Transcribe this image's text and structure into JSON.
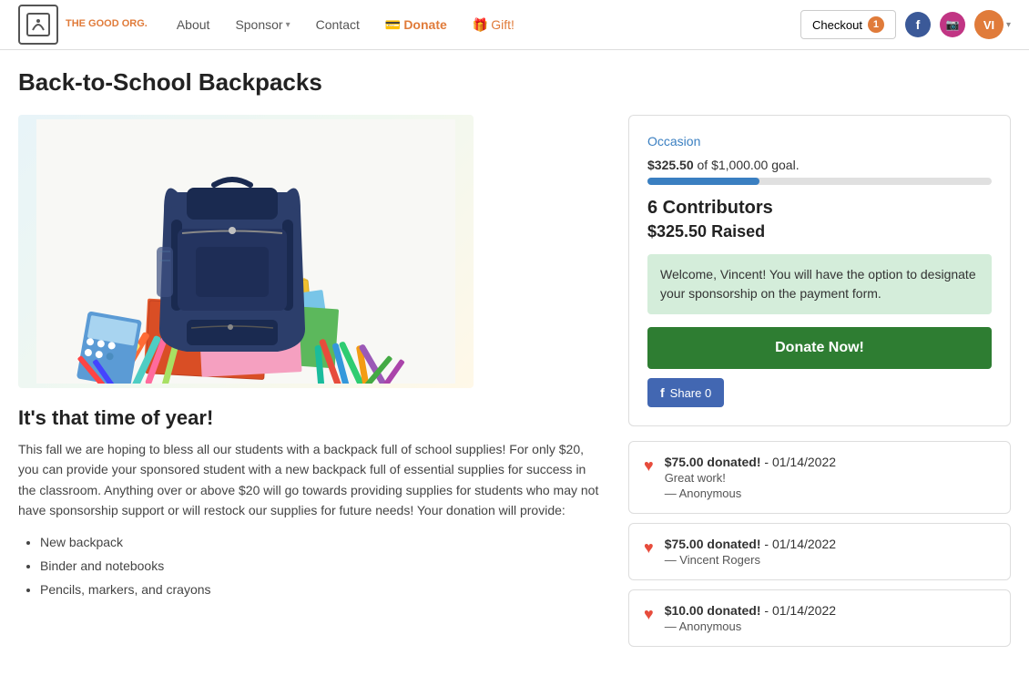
{
  "nav": {
    "logo_text": "THE GOOD ORG.",
    "logo_symbol": "🌿",
    "links": [
      {
        "label": "About",
        "id": "about"
      },
      {
        "label": "Sponsor",
        "id": "sponsor",
        "hasDropdown": true
      },
      {
        "label": "Contact",
        "id": "contact"
      },
      {
        "label": "Donate",
        "id": "donate",
        "icon": "💳"
      },
      {
        "label": "Gift!",
        "id": "gift",
        "icon": "🎁"
      }
    ],
    "checkout_label": "Checkout",
    "checkout_count": "1",
    "avatar_initials": "VI"
  },
  "page": {
    "title": "Back-to-School Backpacks"
  },
  "campaign": {
    "occasion_label": "Occasion",
    "goal_current": "$325.50",
    "goal_total": "$1,000.00",
    "goal_text": " of $1,000.00 goal.",
    "progress_percent": 32.55,
    "contributors_label": "6 Contributors",
    "raised_label": "$325.50 Raised",
    "welcome_message": "Welcome, Vincent! You will have the option to designate your sponsorship on the payment form.",
    "donate_button": "Donate Now!",
    "fb_share_label": "Share 0"
  },
  "description": {
    "heading": "It's that time of year!",
    "body": "This fall we are hoping to bless all our students with a backpack full of school supplies! For only $20, you can provide your sponsored student with a new backpack full of essential supplies for success in the classroom. Anything over or above $20 will go towards providing supplies for students who may not have sponsorship support or will restock our supplies for future needs! Your donation will provide:",
    "bullets": [
      "New backpack",
      "Binder and notebooks",
      "Pencils, markers, and crayons"
    ]
  },
  "donations": [
    {
      "amount": "$75.00 donated!",
      "date": "- 01/14/2022",
      "note": "Great work!",
      "donor": "— Anonymous"
    },
    {
      "amount": "$75.00 donated!",
      "date": "- 01/14/2022",
      "note": null,
      "donor": "— Vincent Rogers"
    },
    {
      "amount": "$10.00 donated!",
      "date": "- 01/14/2022",
      "note": null,
      "donor": "— Anonymous"
    }
  ]
}
